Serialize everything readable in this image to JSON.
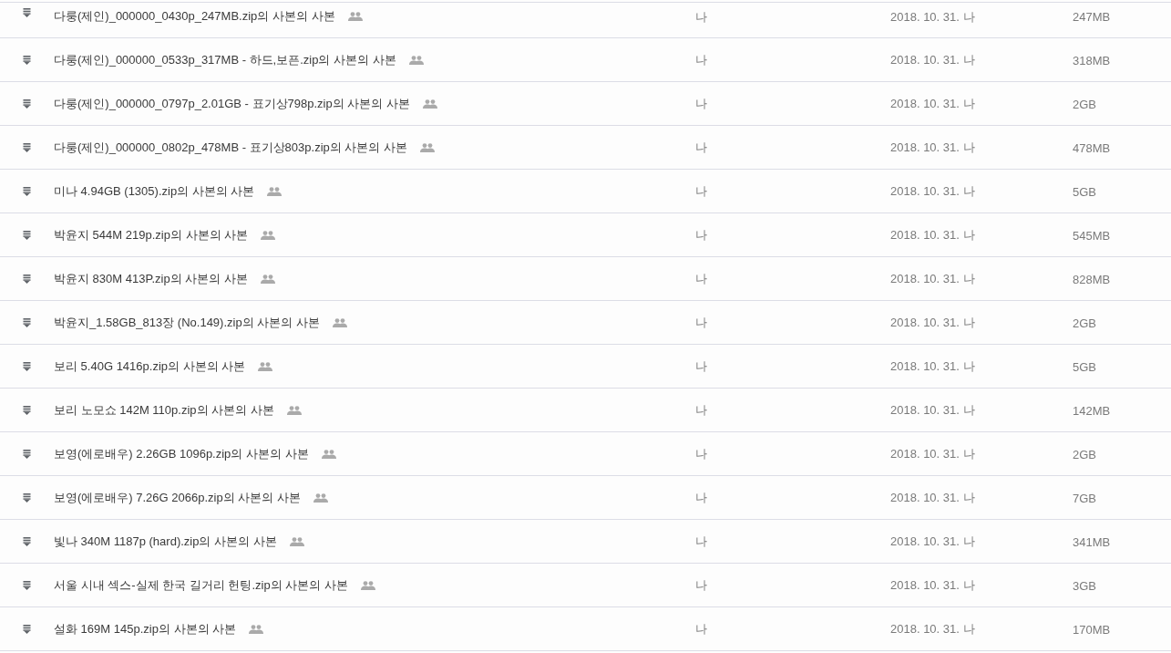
{
  "files": [
    {
      "name": "다룽(제인)_000000_0430p_247MB.zip의 사본의 사본",
      "shared": true,
      "owner": "나",
      "modified": "2018. 10. 31. 나",
      "size": "247MB"
    },
    {
      "name": "다룽(제인)_000000_0533p_317MB - 하드,보픈.zip의 사본의 사본",
      "shared": true,
      "owner": "나",
      "modified": "2018. 10. 31. 나",
      "size": "318MB"
    },
    {
      "name": "다룽(제인)_000000_0797p_2.01GB - 표기상798p.zip의 사본의 사본",
      "shared": true,
      "owner": "나",
      "modified": "2018. 10. 31. 나",
      "size": "2GB"
    },
    {
      "name": "다룽(제인)_000000_0802p_478MB - 표기상803p.zip의 사본의 사본",
      "shared": true,
      "owner": "나",
      "modified": "2018. 10. 31. 나",
      "size": "478MB"
    },
    {
      "name": "미나 4.94GB (1305).zip의 사본의 사본",
      "shared": true,
      "owner": "나",
      "modified": "2018. 10. 31. 나",
      "size": "5GB"
    },
    {
      "name": "박윤지 544M 219p.zip의 사본의 사본",
      "shared": true,
      "owner": "나",
      "modified": "2018. 10. 31. 나",
      "size": "545MB"
    },
    {
      "name": "박윤지 830M 413P.zip의 사본의 사본",
      "shared": true,
      "owner": "나",
      "modified": "2018. 10. 31. 나",
      "size": "828MB"
    },
    {
      "name": "박윤지_1.58GB_813장 (No.149).zip의 사본의 사본",
      "shared": true,
      "owner": "나",
      "modified": "2018. 10. 31. 나",
      "size": "2GB"
    },
    {
      "name": "보리 5.40G 1416p.zip의 사본의 사본",
      "shared": true,
      "owner": "나",
      "modified": "2018. 10. 31. 나",
      "size": "5GB"
    },
    {
      "name": "보리 노모쇼 142M 110p.zip의 사본의 사본",
      "shared": true,
      "owner": "나",
      "modified": "2018. 10. 31. 나",
      "size": "142MB"
    },
    {
      "name": "보영(에로배우) 2.26GB 1096p.zip의 사본의 사본",
      "shared": true,
      "owner": "나",
      "modified": "2018. 10. 31. 나",
      "size": "2GB"
    },
    {
      "name": "보영(에로배우) 7.26G 2066p.zip의 사본의 사본",
      "shared": true,
      "owner": "나",
      "modified": "2018. 10. 31. 나",
      "size": "7GB"
    },
    {
      "name": "빛나 340M 1187p (hard).zip의 사본의 사본",
      "shared": true,
      "owner": "나",
      "modified": "2018. 10. 31. 나",
      "size": "341MB"
    },
    {
      "name": "서울 시내 섹스-실제 한국 길거리 헌팅.zip의 사본의 사본",
      "shared": true,
      "owner": "나",
      "modified": "2018. 10. 31. 나",
      "size": "3GB"
    },
    {
      "name": "설화 169M 145p.zip의 사본의 사본",
      "shared": true,
      "owner": "나",
      "modified": "2018. 10. 31. 나",
      "size": "170MB"
    }
  ]
}
